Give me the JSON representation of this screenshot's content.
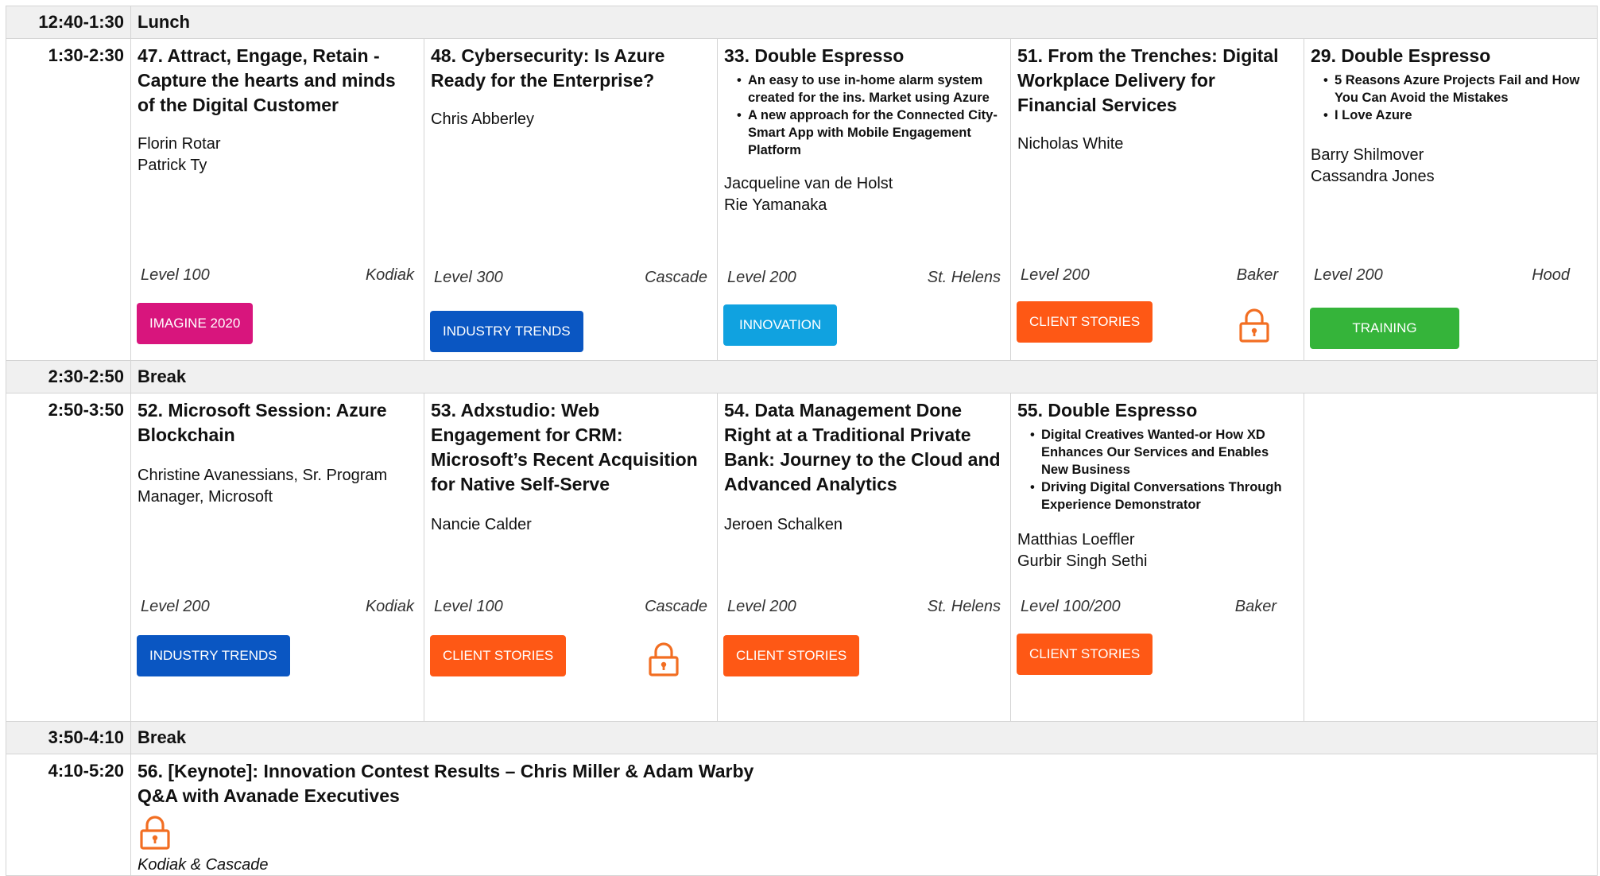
{
  "colors": {
    "imagine_2020": "#d8157d",
    "industry_trends": "#0a56c2",
    "innovation": "#10a2e0",
    "client_stories": "#fe5815",
    "training": "#35b43a",
    "lock": "#f26e22"
  },
  "lunch": {
    "time": "12:40-1:30",
    "label": "Lunch"
  },
  "row1": {
    "time": "1:30-2:30",
    "s1": {
      "title": "47.  Attract, Engage, Retain - Capture the hearts and minds of the Digital Customer",
      "speakers": [
        "Florin Rotar",
        "Patrick Ty"
      ],
      "level": "Level 100",
      "room": "Kodiak",
      "tag": "IMAGINE 2020"
    },
    "s2": {
      "title": "48. Cybersecurity: Is Azure Ready for the Enterprise?",
      "speakers": [
        "Chris Abberley"
      ],
      "level": "Level 300",
      "room": "Cascade",
      "tag": "INDUSTRY TRENDS"
    },
    "s3": {
      "title": "33. Double Espresso",
      "bullets": [
        "An easy to use in-home alarm system created for the ins. Market using Azure",
        "A new approach for the Connected City-Smart App with Mobile Engagement Platform"
      ],
      "speakers": [
        "Jacqueline van de Holst",
        "Rie Yamanaka"
      ],
      "level": "Level 200",
      "room": "St. Helens",
      "tag": "INNOVATION"
    },
    "s4": {
      "title": "51.  From the Trenches: Digital Workplace Delivery for Financial Services",
      "speakers": [
        "Nicholas White"
      ],
      "level": "Level 200",
      "room": "Baker",
      "tag": "CLIENT STORIES",
      "lock_icon": "lock-icon"
    },
    "s5": {
      "title": "29. Double Espresso",
      "bullets": [
        "5 Reasons Azure Projects Fail and How You Can Avoid the Mistakes",
        "I Love Azure"
      ],
      "speakers": [
        "Barry Shilmover",
        "Cassandra Jones"
      ],
      "level": "Level 200",
      "room": "Hood",
      "tag": "TRAINING"
    }
  },
  "break1": {
    "time": "2:30-2:50",
    "label": "Break"
  },
  "row2": {
    "time": "2:50-3:50",
    "s1": {
      "title": "52. Microsoft Session: Azure Blockchain",
      "speakers": [
        "Christine Avanessians, Sr. Program Manager, Microsoft"
      ],
      "level": "Level 200",
      "room": "Kodiak",
      "tag": "INDUSTRY TRENDS"
    },
    "s2": {
      "title": "53. Adxstudio: Web Engagement for CRM: Microsoft’s Recent Acquisition for Native Self-Serve",
      "speakers": [
        "Nancie Calder"
      ],
      "level": "Level 100",
      "room": "Cascade",
      "tag": "CLIENT STORIES",
      "lock_icon": "lock-icon"
    },
    "s3": {
      "title": "54. Data Management Done Right at a Traditional Private Bank: Journey to the Cloud and Advanced Analytics",
      "speakers": [
        "Jeroen Schalken"
      ],
      "level": "Level 200",
      "room": "St. Helens",
      "tag": "CLIENT STORIES"
    },
    "s4": {
      "title": "55. Double Espresso",
      "bullets": [
        "Digital Creatives Wanted-or How XD Enhances Our Services and Enables New Business",
        "Driving Digital Conversations Through Experience Demonstrator"
      ],
      "speakers": [
        "Matthias Loeffler",
        "Gurbir Singh Sethi"
      ],
      "level": "Level 100/200",
      "room": "Baker",
      "tag": "CLIENT STORIES"
    }
  },
  "break2": {
    "time": "3:50-4:10",
    "label": "Break"
  },
  "keynote": {
    "time": "4:10-5:20",
    "title_line1": "56. [Keynote]: Innovation Contest Results – Chris Miller & Adam Warby",
    "title_line2": "Q&A with Avanade Executives",
    "lock_icon": "lock-icon",
    "room": "Kodiak & Cascade"
  }
}
